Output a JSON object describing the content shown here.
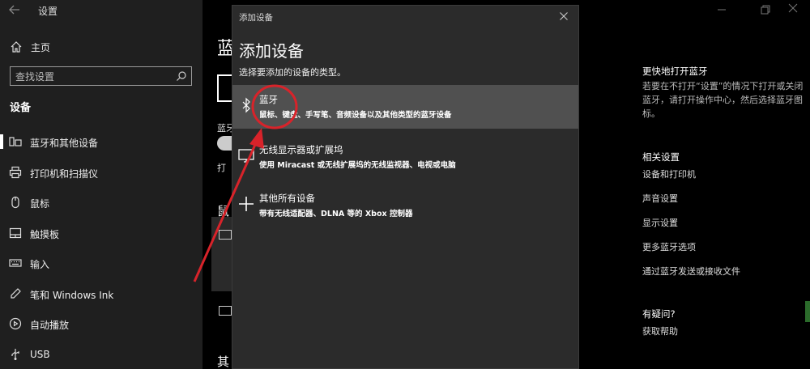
{
  "settings": {
    "title": "设置",
    "home": "主页",
    "search_placeholder": "查找设置",
    "section": "设备",
    "nav_items": [
      {
        "label": "蓝牙和其他设备",
        "icon": "bluetooth-devices-icon"
      },
      {
        "label": "打印机和扫描仪",
        "icon": "printer-icon"
      },
      {
        "label": "鼠标",
        "icon": "mouse-icon"
      },
      {
        "label": "触摸板",
        "icon": "touchpad-icon"
      },
      {
        "label": "输入",
        "icon": "keyboard-icon"
      },
      {
        "label": "笔和 Windows Ink",
        "icon": "pen-icon"
      },
      {
        "label": "自动播放",
        "icon": "autoplay-icon"
      },
      {
        "label": "USB",
        "icon": "usb-icon"
      }
    ]
  },
  "background_page": {
    "heading": "蓝",
    "bt_label": "蓝牙",
    "open_label": "打",
    "mouse_heading": "鼠",
    "other_heading": "其"
  },
  "right_panel": {
    "quick_heading": "更快地打开蓝牙",
    "quick_text": "若要在不打开“设置”的情况下打开或关闭蓝牙，请打开操作中心，然后选择蓝牙图标。",
    "related_heading": "相关设置",
    "related_links": [
      "设备和打印机",
      "声音设置",
      "显示设置",
      "更多蓝牙选项",
      "通过蓝牙发送或接收文件"
    ],
    "question_heading": "有疑问?",
    "help_link": "获取帮助"
  },
  "dialog": {
    "title": "添加设备",
    "heading": "添加设备",
    "subtitle": "选择要添加的设备的类型。",
    "options": [
      {
        "name": "蓝牙",
        "desc": "鼠标、键盘、手写笔、音频设备以及其他类型的蓝牙设备",
        "icon": "bluetooth-icon",
        "selected": true
      },
      {
        "name": "无线显示器或扩展坞",
        "desc": "使用 Miracast 或无线扩展坞的无线监视器、电视或电脑",
        "icon": "monitor-icon",
        "selected": false
      },
      {
        "name": "其他所有设备",
        "desc": "带有无线适配器、DLNA 等的 Xbox 控制器",
        "icon": "plus-icon",
        "selected": false
      }
    ]
  },
  "colors": {
    "nav_bg": "#1f1f1f",
    "dialog_bg": "#2b2b2b",
    "selected_bg": "#505050",
    "annotation_red": "#d8232a"
  }
}
